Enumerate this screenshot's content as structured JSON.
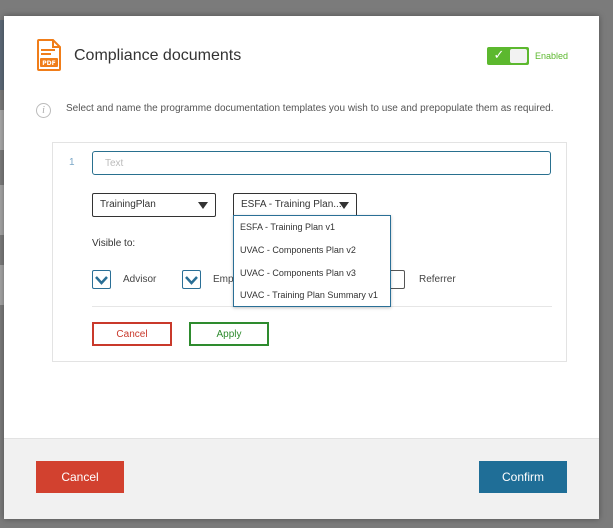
{
  "modal": {
    "title": "Compliance documents",
    "toggle": {
      "enabled": true,
      "label": "Enabled"
    },
    "info_text": "Select and name the programme documentation templates you wish to use and prepopulate them as required.",
    "document_row": {
      "number": "1",
      "name_field": {
        "value": "",
        "placeholder": "Text"
      },
      "plan_type_select": {
        "selected": "TrainingPlan"
      },
      "template_select": {
        "selected": "ESFA - Training Plan...",
        "open": true,
        "options": [
          "ESFA - Training Plan v1",
          "UVAC - Components Plan v2",
          "UVAC - Components Plan v3",
          "UVAC - Training Plan Summary v1"
        ]
      },
      "visible_to_label": "Visible to:",
      "visibility": [
        {
          "label": "Advisor",
          "checked": true
        },
        {
          "label": "Emp",
          "checked": true
        },
        {
          "label": "Referrer",
          "checked": false
        }
      ],
      "cancel_label": "Cancel",
      "apply_label": "Apply"
    }
  },
  "footer": {
    "cancel_label": "Cancel",
    "confirm_label": "Confirm"
  },
  "colors": {
    "accent": "#1f6e97",
    "danger": "#d2412f",
    "success": "#5cb82e",
    "pdf_icon": "#f07d19"
  }
}
